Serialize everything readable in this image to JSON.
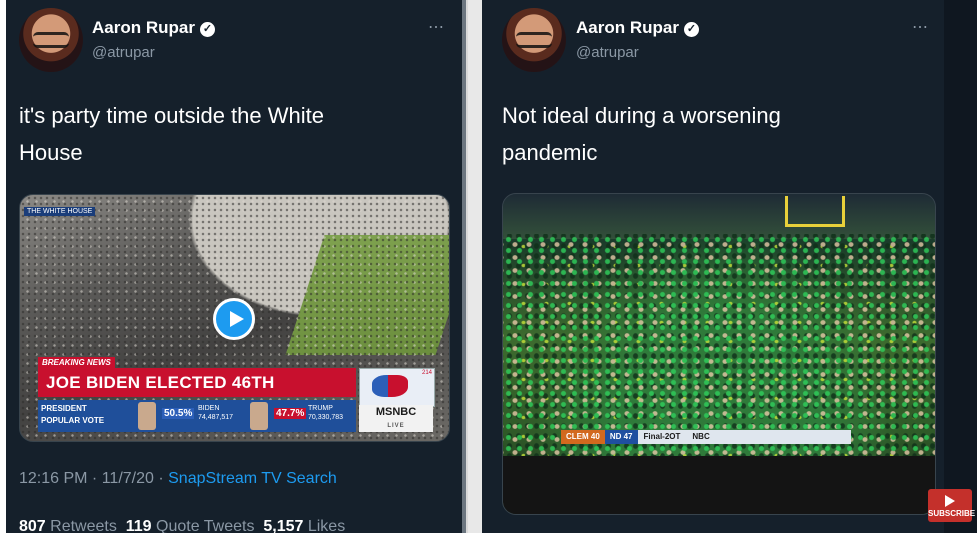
{
  "left_tweet": {
    "author_name": "Aaron Rupar",
    "author_handle": "@atrupar",
    "more_icon": "⋯",
    "text_line1": "it's party time outside the White",
    "text_line2": "House",
    "video": {
      "tag": "THE WHITE HOUSE",
      "breaking": "BREAKING NEWS",
      "headline": "JOE BIDEN ELECTED 46TH PRESIDENT",
      "vote_label_1": "PRESIDENT",
      "vote_label_2": "POPULAR VOTE",
      "biden_pct": "50.5%",
      "biden_name": "BIDEN",
      "biden_votes": "74,487,517",
      "trump_pct": "47.7%",
      "trump_name": "TRUMP",
      "trump_votes": "70,330,783",
      "map_num": "214",
      "network": "MSNBC",
      "live": "LIVE"
    },
    "time": "12:16 PM · 11/7/20 · ",
    "source": "SnapStream TV Search",
    "retweets": "807",
    "retweets_label": "Retweets",
    "quotes": "119",
    "quotes_label": "Quote Tweets",
    "likes": "5,157",
    "likes_label": "Likes"
  },
  "right_tweet": {
    "author_name": "Aaron Rupar",
    "author_handle": "@atrupar",
    "more_icon": "⋯",
    "text_line1": "Not ideal during a worsening",
    "text_line2": "pandemic",
    "video": {
      "score_a_team": "CLEM",
      "score_a": "40",
      "score_b_team": "ND",
      "score_b": "47",
      "final": "Final-2OT",
      "network": "NBC"
    }
  },
  "subscribe_label": "SUBSCRIBE",
  "colors": {
    "background": "#15202b",
    "accent": "#1d9bf0",
    "breaking_red": "#c8102e"
  }
}
